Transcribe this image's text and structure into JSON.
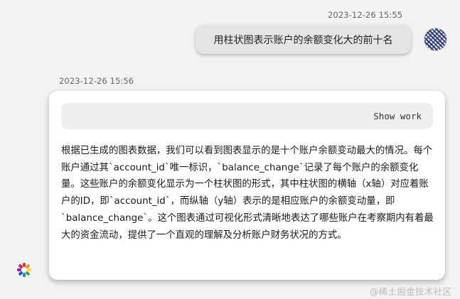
{
  "conversation": {
    "user_message": {
      "timestamp": "2023-12-26 15:55",
      "text": "用柱状图表示账户的余额变化大的前十名"
    },
    "assistant_message": {
      "timestamp": "2023-12-26 15:56",
      "show_work_label": "Show work",
      "text": "根据已生成的图表数据，我们可以看到图表显示的是十个账户余额变动最大的情况。每个账户通过其`account_id`唯一标识，`balance_change`记录了每个账户的余额变化量。这些账户的余额变化显示为一个柱状图的形式，其中柱状图的横轴（x轴）对应着账户的ID，即`account_id`，而纵轴（y轴）表示的是相应账户的余额变动量，即`balance_change`。这个图表通过可视化形式清晰地表达了哪些账户在考察期内有着最大的资金流动，提供了一个直观的理解及分析账户财务状况的方式。"
    }
  },
  "icons": {
    "user_avatar": "user-avatar-icon",
    "assistant_avatar": "assistant-logo-icon"
  },
  "watermark": "@稀土掘金技术社区",
  "colors": {
    "background": "#f2f2f2",
    "user_bubble": "#e4e4e4",
    "card": "#ffffff",
    "show_work_bg": "#efefef",
    "avatar_blue": "#2d3a7a"
  }
}
